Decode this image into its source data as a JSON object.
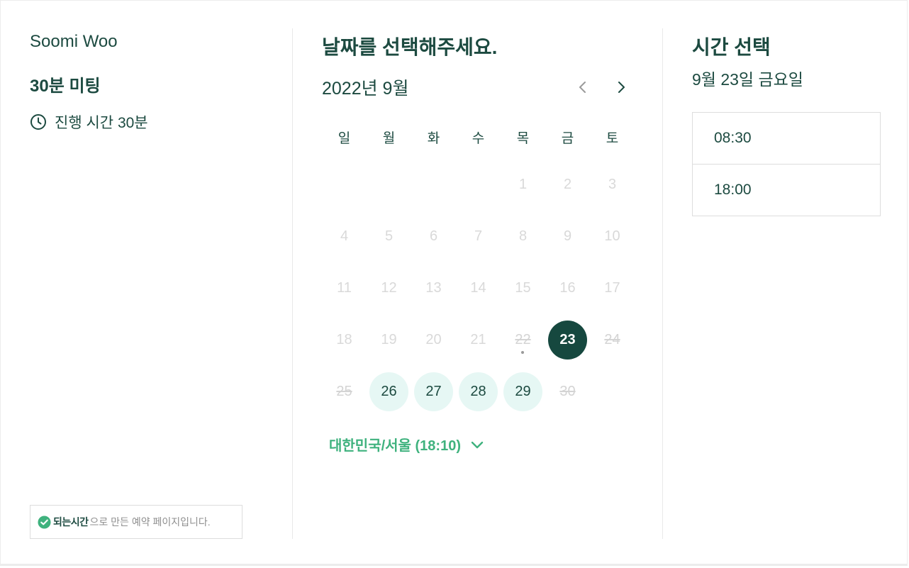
{
  "host": {
    "name": "Soomi Woo"
  },
  "meeting": {
    "title": "30분 미팅",
    "duration_label": "진행 시간 30분"
  },
  "brand": {
    "name": "되는시간",
    "suffix": "으로 만든 예약 페이지입니다."
  },
  "calendar": {
    "heading": "날짜를 선택해주세요.",
    "month_label": "2022년 9월",
    "weekdays": [
      "일",
      "월",
      "화",
      "수",
      "목",
      "금",
      "토"
    ],
    "days": {
      "d1": "1",
      "d2": "2",
      "d3": "3",
      "d4": "4",
      "d5": "5",
      "d6": "6",
      "d7": "7",
      "d8": "8",
      "d9": "9",
      "d10": "10",
      "d11": "11",
      "d12": "12",
      "d13": "13",
      "d14": "14",
      "d15": "15",
      "d16": "16",
      "d17": "17",
      "d18": "18",
      "d19": "19",
      "d20": "20",
      "d21": "21",
      "d22": "22",
      "d23": "23",
      "d24": "24",
      "d25": "25",
      "d26": "26",
      "d27": "27",
      "d28": "28",
      "d29": "29",
      "d30": "30"
    },
    "selected_day": "23",
    "available_days": [
      "26",
      "27",
      "28",
      "29"
    ],
    "timezone_label": "대한민국/서울 (18:10)"
  },
  "time_select": {
    "heading": "시간 선택",
    "date_label": "9월 23일 금요일",
    "slots": [
      "08:30",
      "18:00"
    ]
  },
  "colors": {
    "primary": "#16483f",
    "available_bg": "#e6f7f4",
    "accent_green": "#3fb27e",
    "muted": "#d9d9d9"
  }
}
